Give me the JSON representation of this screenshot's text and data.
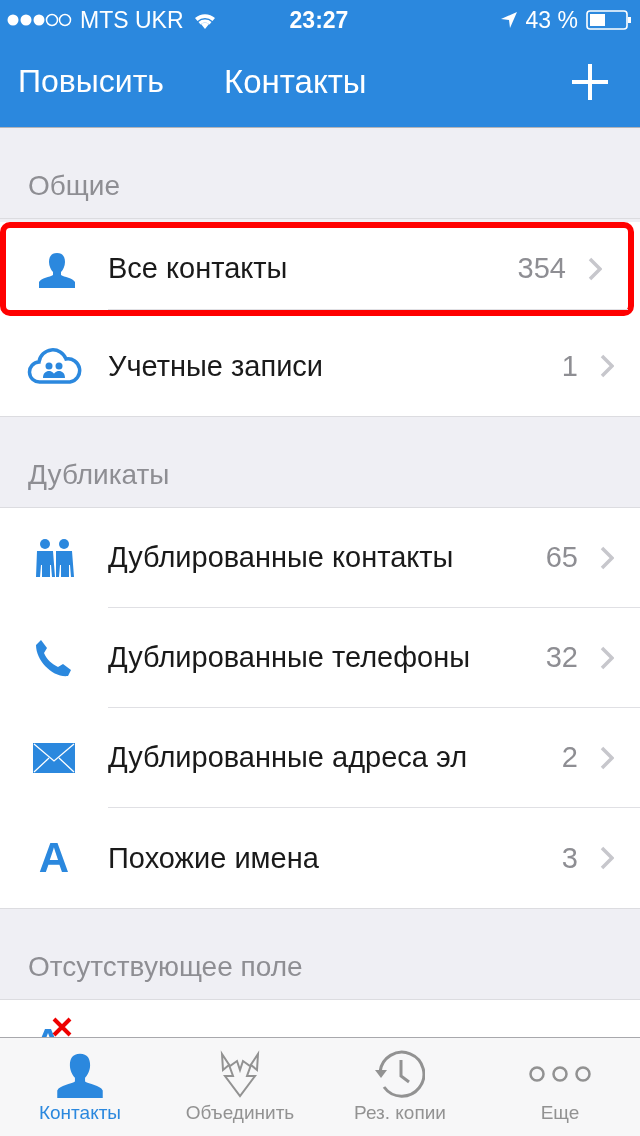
{
  "status_bar": {
    "carrier": "MTS UKR",
    "time": "23:27",
    "battery": "43 %"
  },
  "nav_bar": {
    "left_button": "Повысить",
    "title": "Контакты"
  },
  "sections": [
    {
      "title": "Общие",
      "items": [
        {
          "kind": "person",
          "label": "Все контакты",
          "count": "354",
          "highlighted": true
        },
        {
          "kind": "cloud",
          "label": "Учетные записи",
          "count": "1",
          "highlighted": false
        }
      ]
    },
    {
      "title": "Дубликаты",
      "items": [
        {
          "kind": "people",
          "label": "Дублированные контакты",
          "count": "65",
          "highlighted": false
        },
        {
          "kind": "phone",
          "label": "Дублированные телефоны",
          "count": "32",
          "highlighted": false
        },
        {
          "kind": "mail",
          "label": "Дублированные адреса эл",
          "count": "2",
          "highlighted": false
        },
        {
          "kind": "letter",
          "glyph": "A",
          "label": "Похожие имена",
          "count": "3",
          "highlighted": false
        }
      ]
    },
    {
      "title": "Отсутствующее поле",
      "items": [
        {
          "kind": "letter-cross",
          "highlighted": false
        }
      ]
    }
  ],
  "tab_bar": [
    {
      "kind": "person",
      "label": "Контакты",
      "selected": true
    },
    {
      "kind": "merge",
      "label": "Объединить",
      "selected": false
    },
    {
      "kind": "history",
      "label": "Рез. копии",
      "selected": false
    },
    {
      "kind": "dots",
      "label": "Еще",
      "selected": false
    }
  ]
}
